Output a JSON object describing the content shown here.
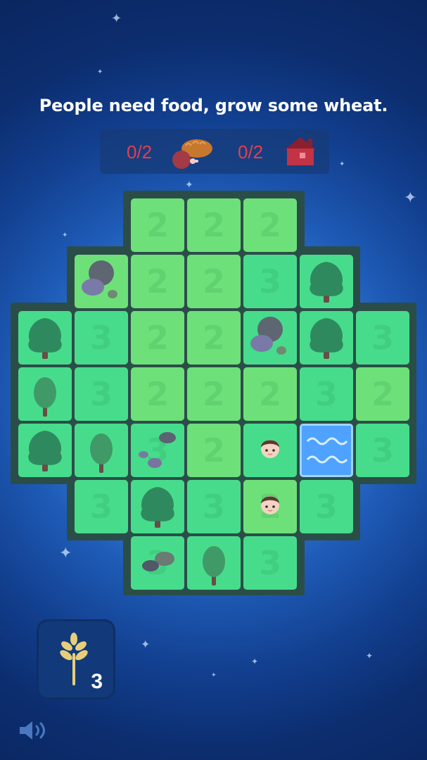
{
  "objective_text": "People need food, grow some wheat.",
  "goals": [
    {
      "count": "0/2",
      "icon": "food-icon"
    },
    {
      "count": "0/2",
      "icon": "house-icon"
    }
  ],
  "board": {
    "rows": [
      [
        null,
        null,
        {
          "n": "2",
          "c": "light"
        },
        {
          "n": "2",
          "c": "light"
        },
        {
          "n": "2",
          "c": "light"
        },
        null,
        null
      ],
      [
        null,
        {
          "n": "",
          "c": "light",
          "item": "rocks"
        },
        {
          "n": "2",
          "c": "light"
        },
        {
          "n": "2",
          "c": "light"
        },
        {
          "n": "3",
          "c": "teal"
        },
        {
          "n": "",
          "c": "teal",
          "item": "tree"
        },
        null
      ],
      [
        {
          "n": "",
          "c": "teal",
          "item": "tree"
        },
        {
          "n": "3",
          "c": "teal"
        },
        {
          "n": "2",
          "c": "light"
        },
        {
          "n": "2",
          "c": "light"
        },
        {
          "n": "",
          "c": "teal",
          "item": "rocks"
        },
        {
          "n": "",
          "c": "teal",
          "item": "tree"
        },
        {
          "n": "3",
          "c": "teal"
        }
      ],
      [
        {
          "n": "",
          "c": "teal",
          "item": "sapling"
        },
        {
          "n": "3",
          "c": "teal"
        },
        {
          "n": "2",
          "c": "light"
        },
        {
          "n": "2",
          "c": "light"
        },
        {
          "n": "2",
          "c": "light"
        },
        {
          "n": "3",
          "c": "teal"
        },
        {
          "n": "2",
          "c": "light"
        }
      ],
      [
        {
          "n": "",
          "c": "teal",
          "item": "tree"
        },
        {
          "n": "",
          "c": "teal",
          "item": "sapling"
        },
        {
          "n": "3",
          "c": "teal",
          "item": "pebbles"
        },
        {
          "n": "2",
          "c": "light"
        },
        {
          "n": "",
          "c": "teal",
          "item": "person"
        },
        {
          "n": "",
          "c": "water",
          "item": "water"
        },
        {
          "n": "3",
          "c": "teal"
        }
      ],
      [
        null,
        {
          "n": "3",
          "c": "teal"
        },
        {
          "n": "",
          "c": "teal",
          "item": "tree"
        },
        {
          "n": "3",
          "c": "teal"
        },
        {
          "n": "2",
          "c": "light",
          "item": "person"
        },
        {
          "n": "3",
          "c": "teal"
        },
        null
      ],
      [
        null,
        null,
        {
          "n": "3",
          "c": "teal",
          "item": "rocks-small"
        },
        {
          "n": "",
          "c": "teal",
          "item": "sapling"
        },
        {
          "n": "3",
          "c": "teal"
        },
        null,
        null
      ]
    ]
  },
  "inventory": {
    "item": "wheat-icon",
    "count": "3"
  },
  "sound_icon": "speaker-icon",
  "colors": {
    "text_white": "#ffffff",
    "goal_red": "#e53e4e",
    "tile_light": "#6ee07a",
    "tile_teal": "#47dc8c",
    "board_border": "#2b4d48",
    "water": "#4fa2ff"
  }
}
